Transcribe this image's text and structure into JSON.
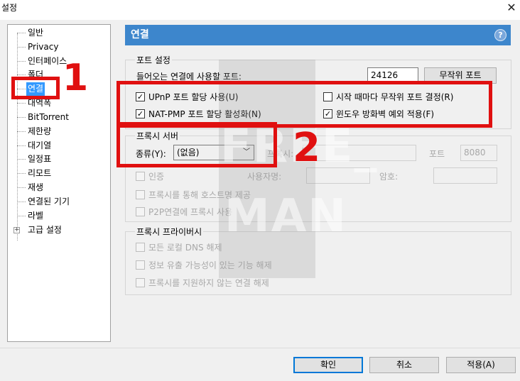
{
  "window": {
    "title": "설정"
  },
  "tree": {
    "items": [
      {
        "label": "일반"
      },
      {
        "label": "Privacy"
      },
      {
        "label": "인터페이스"
      },
      {
        "label": "폴더"
      },
      {
        "label": "연결"
      },
      {
        "label": "대역폭"
      },
      {
        "label": "BitTorrent"
      },
      {
        "label": "제한량"
      },
      {
        "label": "대기열"
      },
      {
        "label": "일정표"
      },
      {
        "label": "리모트"
      },
      {
        "label": "재생"
      },
      {
        "label": "연결된 기기"
      },
      {
        "label": "라벨"
      },
      {
        "label": "고급 설정"
      }
    ],
    "selected": "연결"
  },
  "panel": {
    "title": "연결",
    "help": "?"
  },
  "port_settings": {
    "title": "포트 설정",
    "incoming_port_label": "들어오는 연결에 사용할 포트:",
    "incoming_port_value": "24126",
    "random_port_button": "무작위 포트",
    "upnp_label": "UPnP 포트 할당 사용(U)",
    "natpmp_label": "NAT-PMP 포트 할당 활성화(N)",
    "random_each_start_label": "시작 때마다 무작위 포트 결정(R)",
    "firewall_exception_label": "윈도우 방화벽 예외 적용(F)"
  },
  "proxy_server": {
    "title": "프록시 서버",
    "type_label": "종류(Y):",
    "type_value": "(없음)",
    "proxy_label": "프록시:",
    "port_label": "포트",
    "port_value": "8080",
    "auth_label": "인증",
    "username_label": "사용자명:",
    "password_label": "암호:",
    "hostname_lookup_label": "프록시를 통해 호스트명 제공",
    "p2p_label": "P2P연결에 프록시 사용"
  },
  "proxy_privacy": {
    "title": "프록시 프라이버시",
    "dns_label": "모든 로컬 DNS 해제",
    "leak_label": "정보 유출 가능성이 있는 기능 해제",
    "unsupported_label": "프록시를 지원하지 않는 연결 해제"
  },
  "buttons": {
    "ok": "확인",
    "cancel": "취소",
    "apply": "적용(A)"
  },
  "annotations": {
    "num1": "1",
    "num2": "2"
  },
  "watermark": {
    "line1": "FREE_",
    "line2": "MAN"
  },
  "colors": {
    "accent": "#3d86cc",
    "selection": "#3399ff",
    "annotation": "#e01010"
  }
}
